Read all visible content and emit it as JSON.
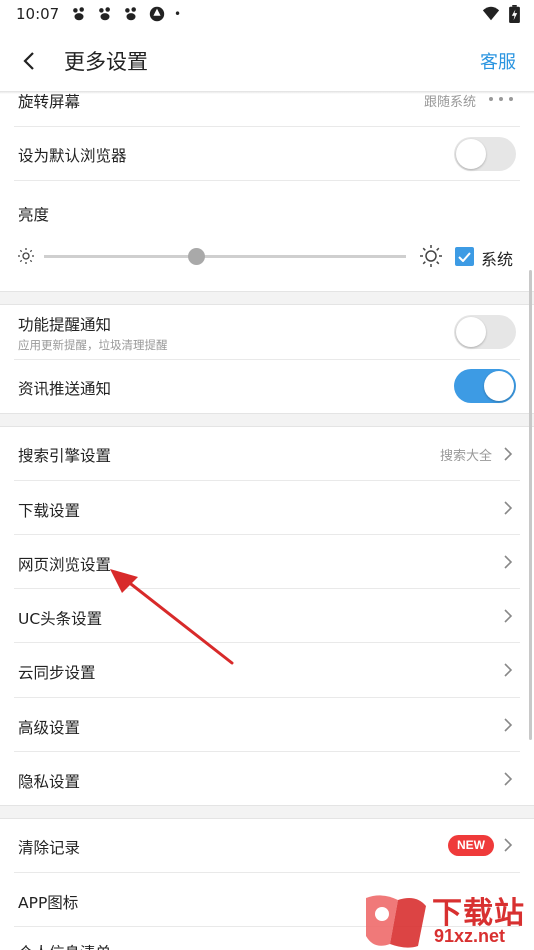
{
  "status": {
    "time": "10:07",
    "dot": "•"
  },
  "header": {
    "title": "更多设置",
    "service": "客服"
  },
  "rows": {
    "rotate": {
      "label": "旋转屏幕",
      "value": "跟随系统"
    },
    "default_browser": {
      "label": "设为默认浏览器",
      "toggle": false
    },
    "brightness": {
      "label": "亮度",
      "system_label": "系统",
      "system_checked": true,
      "level": 0.42
    },
    "feature_notify": {
      "label": "功能提醒通知",
      "sub": "应用更新提醒，垃圾清理提醒",
      "toggle": false
    },
    "news_push": {
      "label": "资讯推送通知",
      "toggle": true
    },
    "search_engine": {
      "label": "搜索引擎设置",
      "value": "搜索大全"
    },
    "download": {
      "label": "下载设置"
    },
    "web_browse": {
      "label": "网页浏览设置"
    },
    "uc_headline": {
      "label": "UC头条设置"
    },
    "cloud_sync": {
      "label": "云同步设置"
    },
    "advanced": {
      "label": "高级设置"
    },
    "privacy": {
      "label": "隐私设置"
    },
    "clear_records": {
      "label": "清除记录",
      "badge": "NEW"
    },
    "app_icon": {
      "label": "APP图标"
    },
    "personal_info": {
      "label": "个人信息清单"
    }
  },
  "watermark": {
    "text_top": "下载站",
    "text_bottom": "91xz.net"
  },
  "colors": {
    "accent": "#3d9be4",
    "service": "#2b95e0",
    "badge": "#ef3a3a",
    "arrow": "#d82a2a"
  }
}
